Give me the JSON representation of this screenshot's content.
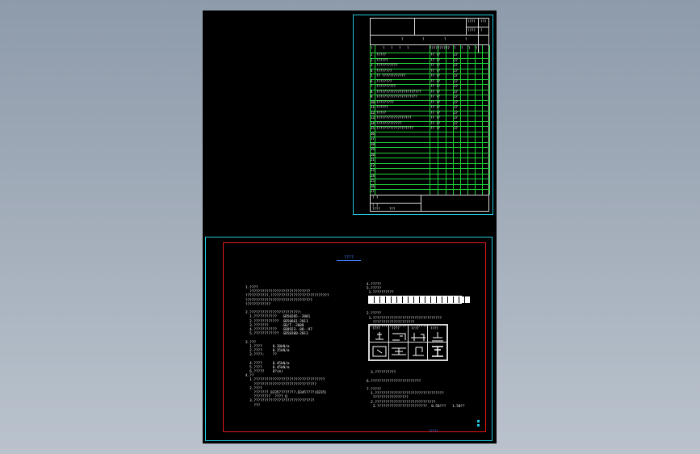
{
  "colors": {
    "background_top": "#8e9bab",
    "sheet": "#000000",
    "table_grid": "#1fd23a",
    "frame_cyan": "#20c8e0",
    "frame_red": "#e01818",
    "title_blue": "#3f7cff"
  },
  "bom": {
    "header_marks": [
      "?",
      "?",
      "?",
      "?"
    ],
    "top_right_marks": [
      "????",
      "???",
      "????",
      "?"
    ],
    "column_marks": [
      "?",
      "?",
      "?",
      "?",
      "?",
      "????",
      "????",
      "??",
      "?",
      "?",
      "?",
      "?"
    ],
    "rows": [
      {
        "n": "1",
        "name": "?????",
        "code": "?? ??",
        "qty": "1?"
      },
      {
        "n": "2",
        "name": "??????",
        "code": "?? ??",
        "qty": "1?"
      },
      {
        "n": "3",
        "name": "???????????",
        "code": "?? ??",
        "qty": "1?"
      },
      {
        "n": "4",
        "name": "????????",
        "code": "?? ??",
        "qty": "1?"
      },
      {
        "n": "5",
        "name": "?? ????????????",
        "code": "?? ??",
        "qty": "1?"
      },
      {
        "n": "6",
        "name": "????????",
        "code": "?? ??",
        "qty": "1?"
      },
      {
        "n": "7",
        "name": "??????????",
        "code": "?? ??",
        "qty": "1?"
      },
      {
        "n": "8",
        "name": "???????????????????????",
        "code": "?? ??",
        "qty": "1?"
      },
      {
        "n": "9",
        "name": "?????????????????????",
        "code": "?? ??",
        "qty": "1?"
      },
      {
        "n": "10",
        "name": "?????????",
        "code": "?? ??",
        "qty": "1?"
      },
      {
        "n": "11",
        "name": "??????",
        "code": "?? ??",
        "qty": "1?"
      },
      {
        "n": "12",
        "name": "?????",
        "code": "?? ??",
        "qty": "1?"
      },
      {
        "n": "13",
        "name": "??????????????????",
        "code": "?? ??",
        "qty": "1?"
      },
      {
        "n": "14",
        "name": "?????????????",
        "code": "?? ??",
        "qty": "1?"
      },
      {
        "n": "15",
        "name": "???????????????????",
        "code": "?? ??",
        "qty": "1?"
      },
      {
        "n": "16",
        "name": "",
        "code": "",
        "qty": ""
      },
      {
        "n": "17",
        "name": "",
        "code": "",
        "qty": ""
      },
      {
        "n": "18",
        "name": "",
        "code": "",
        "qty": ""
      },
      {
        "n": "19",
        "name": "",
        "code": "",
        "qty": ""
      },
      {
        "n": "20",
        "name": "",
        "code": "",
        "qty": ""
      },
      {
        "n": "21",
        "name": "",
        "code": "",
        "qty": ""
      },
      {
        "n": "22",
        "name": "",
        "code": "",
        "qty": ""
      },
      {
        "n": "23",
        "name": "",
        "code": "",
        "qty": ""
      },
      {
        "n": "24",
        "name": "",
        "code": "",
        "qty": ""
      },
      {
        "n": "25",
        "name": "",
        "code": "",
        "qty": ""
      },
      {
        "n": "26",
        "name": "",
        "code": "",
        "qty": ""
      },
      {
        "n": "27",
        "name": "",
        "code": "",
        "qty": ""
      }
    ],
    "footer": [
      "? ?",
      "? ?",
      "????",
      "???"
    ]
  },
  "notes": {
    "title": "????",
    "left_text": "1.????\n  ?????????????????????????????\n???????????,????????????????????????????\n????????????????????????????????\n????????????\n\n2.????????????????????????:\n  1.???????????   GB50205--2001\n  2.????????????  GB50661-2011\n  3.???????       GB/T--2008\n  4.???????????   GB8923--88--97\n  5.????????????  GB50300-2013\n\n3.???\n  1.????     0.30kN/m\n  2.????     0.35kN/m\n  3.????:    ??\n\n  4.????     0.45kN/m\n  5.????     0.45kN/m\n  6.?????    8?(m)\n4.??\n  1.??????????????????????????????????\n    ??????????????????????????????\n  2.????\n    ??????? Q235????????,Q345????(Q235)\n    ????????  ???? Q\n  3.?????????????????????????????\n    ???",
    "right_text": "4.?????\n5.?????\n 1.??????????\n\n\n\n\n2.?????\n 1.?????????????????????????????????\n   ????????????????????\n 2.????????????????     ?????\n\n\n\n\n\n\n\n\n\n\n  3.??????????\n\n6.????????????????????????\n\n7.?????\n  1.?????????????????????????????????\n   ?????????????????\n  2.?????????????????????????????\n   3.????????????????????????  0.50???   1.50??",
    "diagram_labels": [
      "????",
      "????",
      "????",
      "????"
    ],
    "footer_label": "?????"
  }
}
